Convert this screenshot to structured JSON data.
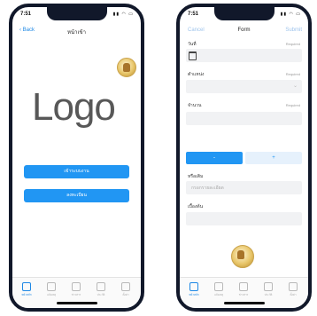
{
  "left_screen": {
    "status_time": "7:51",
    "status_icons": "▮▮ ◠ ▭",
    "nav_back": "‹ Back",
    "nav_title": "หน้าเข้า",
    "logo_text": "Logo",
    "buttons": [
      "เข้าระบบงาน",
      "ลงทะเบียน"
    ],
    "tabs": [
      {
        "label": "หน้าหลัก",
        "icon": "home-icon",
        "active": true
      },
      {
        "label": "แจ้งเหตุ",
        "icon": "document-icon"
      },
      {
        "label": "ข่าวสาร",
        "icon": "bell-icon"
      },
      {
        "label": "ประวัติ",
        "icon": "folder-icon"
      },
      {
        "label": "ตั้งค่า",
        "icon": "settings-icon"
      }
    ]
  },
  "right_screen": {
    "status_time": "7:51",
    "status_icons": "▮▮ ◠ ▭",
    "nav_cancel": "Cancel",
    "nav_title": "Form",
    "nav_submit": "Submit",
    "fields": [
      {
        "label": "วันที่",
        "required": "Required"
      },
      {
        "label": "ตำแหน่ง",
        "required": "Required"
      },
      {
        "label": "จำนวน",
        "required": "Required"
      }
    ],
    "segment_minus": "-",
    "segment_plus": "+",
    "note_label": "หรือเติม",
    "note_placeholder": "กรอกรายละเอียด",
    "extra_label": "เบื้องต้น",
    "tabs": [
      {
        "label": "หน้าหลัก",
        "icon": "home-icon",
        "active": true
      },
      {
        "label": "แจ้งเหตุ",
        "icon": "document-icon"
      },
      {
        "label": "ข่าวสาร",
        "icon": "bell-icon"
      },
      {
        "label": "ประวัติ",
        "icon": "folder-icon"
      },
      {
        "label": "ตั้งค่า",
        "icon": "settings-icon"
      }
    ]
  },
  "colors": {
    "accent": "#2196f3",
    "frame": "#11182a",
    "field_bg": "#f1f2f4",
    "logo_gray": "#585858"
  }
}
